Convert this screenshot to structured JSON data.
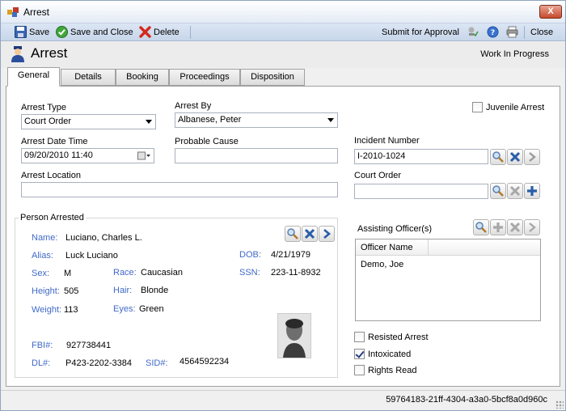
{
  "window": {
    "title": "Arrest",
    "close_glyph": "X"
  },
  "toolbar": {
    "save": "Save",
    "save_close": "Save and Close",
    "delete": "Delete",
    "submit": "Submit for Approval",
    "close": "Close"
  },
  "header": {
    "title": "Arrest",
    "status": "Work In Progress"
  },
  "tabs": [
    "General",
    "Details",
    "Booking",
    "Proceedings",
    "Disposition"
  ],
  "form": {
    "arrest_type_label": "Arrest Type",
    "arrest_type_value": "Court Order",
    "arrest_by_label": "Arrest By",
    "arrest_by_value": "Albanese, Peter",
    "juvenile_label": "Juvenile Arrest",
    "arrest_date_label": "Arrest Date Time",
    "arrest_date_value": "09/20/2010 11:40",
    "probable_cause_label": "Probable Cause",
    "probable_cause_value": "",
    "incident_number_label": "Incident Number",
    "incident_number_value": "I-2010-1024",
    "arrest_location_label": "Arrest Location",
    "arrest_location_value": "",
    "court_order_label": "Court Order",
    "court_order_value": ""
  },
  "person": {
    "group_title": "Person Arrested",
    "name_label": "Name:",
    "name_value": "Luciano, Charles L.",
    "alias_label": "Alias:",
    "alias_value": "Luck Luciano",
    "dob_label": "DOB:",
    "dob_value": "4/21/1979",
    "sex_label": "Sex:",
    "sex_value": "M",
    "race_label": "Race:",
    "race_value": "Caucasian",
    "ssn_label": "SSN:",
    "ssn_value": "223-11-8932",
    "height_label": "Height:",
    "height_value": "505",
    "hair_label": "Hair:",
    "hair_value": "Blonde",
    "weight_label": "Weight:",
    "weight_value": "113",
    "eyes_label": "Eyes:",
    "eyes_value": "Green",
    "fbi_label": "FBI#:",
    "fbi_value": "927738441",
    "dl_label": "DL#:",
    "dl_value": "P423-2202-3384",
    "sid_label": "SID#:",
    "sid_value": "4564592234"
  },
  "officers": {
    "label": "Assisting Officer(s)",
    "column": "Officer Name",
    "rows": [
      "Demo, Joe"
    ]
  },
  "flags": {
    "resisted": {
      "label": "Resisted Arrest",
      "checked": false
    },
    "intoxicated": {
      "label": "Intoxicated",
      "checked": true
    },
    "rights": {
      "label": "Rights Read",
      "checked": false
    }
  },
  "status_bar": {
    "guid": "59764183-21ff-4304-a3a0-5bcf8a0d960c"
  },
  "colors": {
    "label_blue": "#4169c8",
    "toolbar": "#c7d6ea"
  }
}
